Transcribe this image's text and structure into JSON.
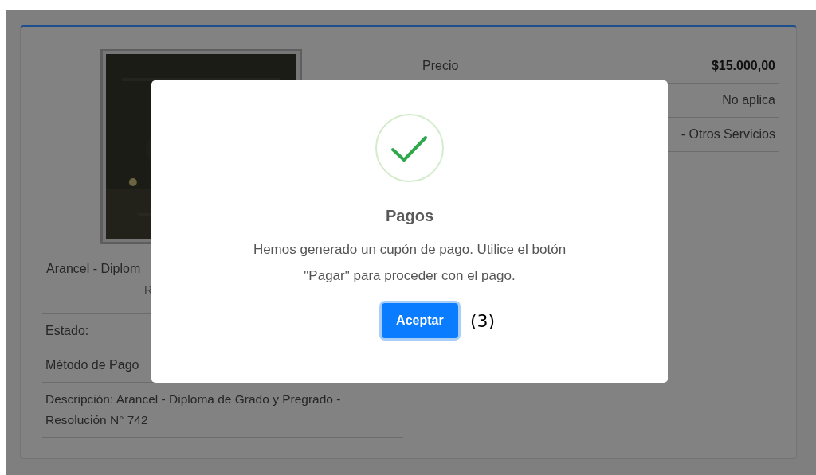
{
  "detail": {
    "caption": "Arancel - Diplom",
    "caption_line_2": "R",
    "left_rows": [
      {
        "text": "Estado:"
      },
      {
        "text": "Método de Pago"
      },
      {
        "text": "Descripción: Arancel - Diploma de Grado y Pregrado - Resolución N° 742"
      }
    ],
    "right_rows": [
      {
        "label": "Precio",
        "value": "$15.000,00",
        "strong": true
      },
      {
        "value": "No aplica",
        "strong": false
      },
      {
        "value": "- Otros Servicios",
        "strong": false
      }
    ]
  },
  "modal": {
    "title": "Pagos",
    "message": "Hemos generado un cupón de pago. Utilice el botón \"Pagar\" para proceder con el pago.",
    "button": "Aceptar",
    "annotation": "(3)"
  }
}
